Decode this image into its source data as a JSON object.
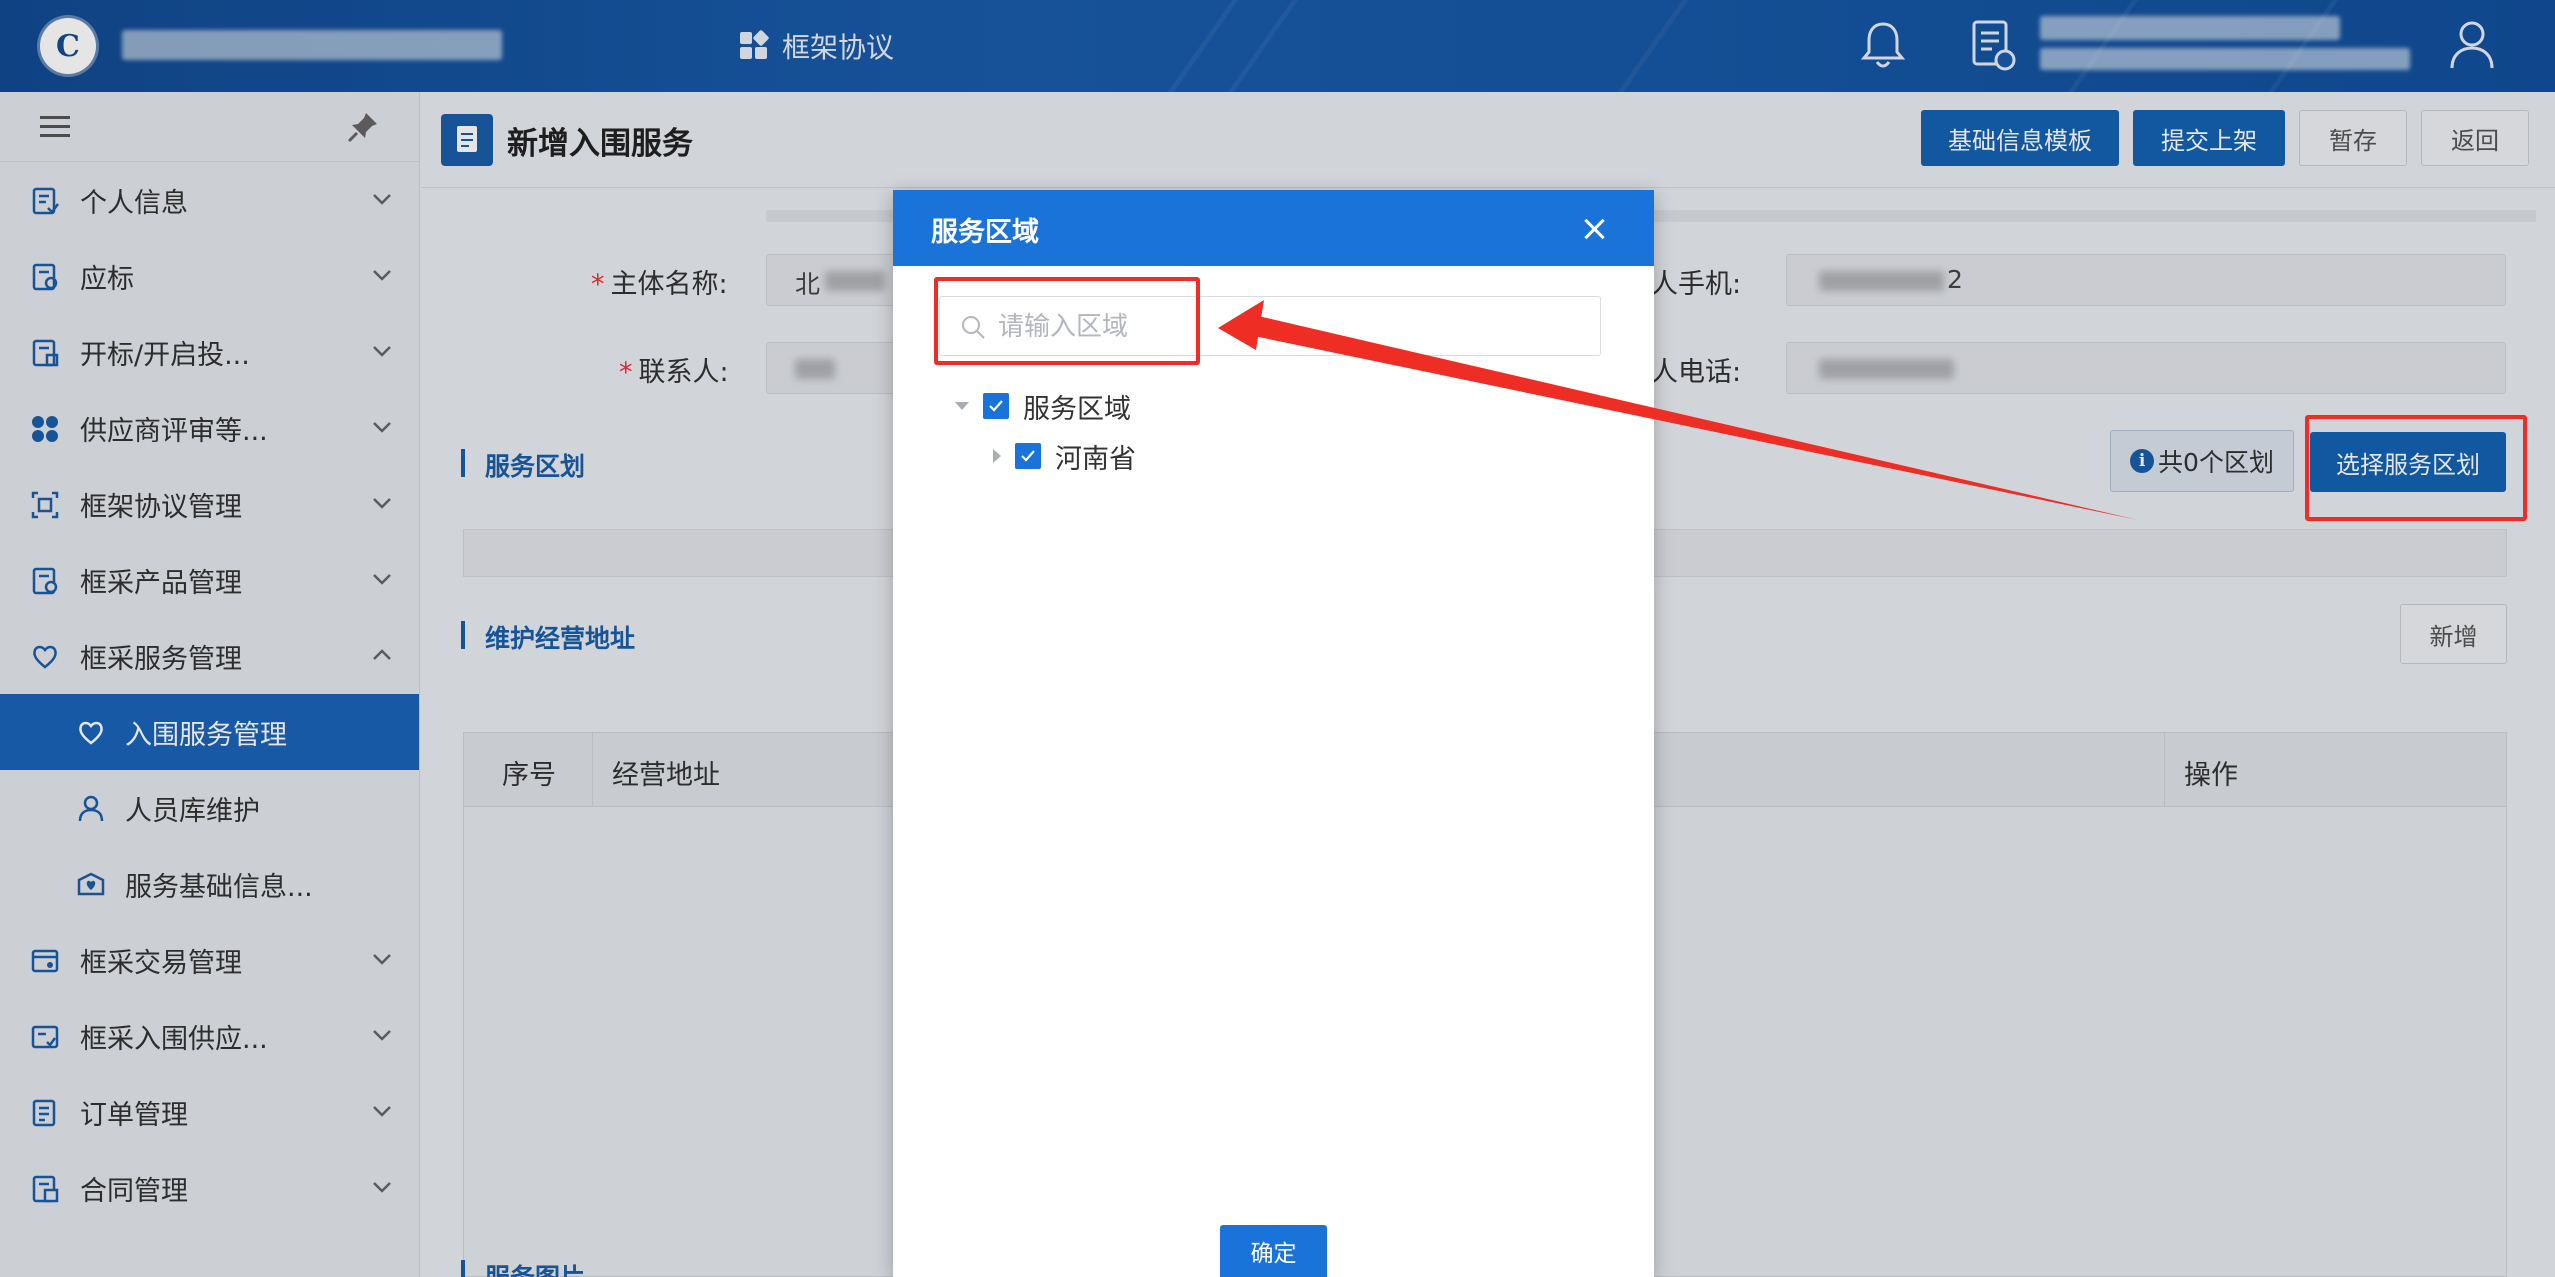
{
  "topbar": {
    "logo_letter": "C",
    "nav_label": "框架协议"
  },
  "sidebar": {
    "items": [
      {
        "label": "个人信息"
      },
      {
        "label": "应标"
      },
      {
        "label": "开标/开启投..."
      },
      {
        "label": "供应商评审等..."
      },
      {
        "label": "框架协议管理"
      },
      {
        "label": "框采产品管理"
      },
      {
        "label": "框采服务管理"
      },
      {
        "label": "入围服务管理"
      },
      {
        "label": "人员库维护"
      },
      {
        "label": "服务基础信息..."
      },
      {
        "label": "框采交易管理"
      },
      {
        "label": "框采入围供应..."
      },
      {
        "label": "订单管理"
      },
      {
        "label": "合同管理"
      }
    ]
  },
  "page": {
    "title": "新增入围服务",
    "buttons": {
      "template": "基础信息模板",
      "submit": "提交上架",
      "save": "暂存",
      "back": "返回"
    },
    "form": {
      "subject_label": "主体名称:",
      "subject_prefix": "北",
      "contact_label": "联系人:",
      "mobile_label": "人手机:",
      "mobile_suffix": "2",
      "phone_label": "人电话:"
    },
    "service_area": {
      "title": "服务区划",
      "count": "共0个区划",
      "select_button": "选择服务区划"
    },
    "address": {
      "title": "维护经营地址",
      "add_button": "新增",
      "columns": [
        "序号",
        "经营地址",
        "操作"
      ]
    },
    "bottom_section": "服务图片"
  },
  "dialog": {
    "title": "服务区域",
    "search_placeholder": "请输入区域",
    "tree": [
      {
        "label": "服务区域",
        "checked": true,
        "expanded": true
      },
      {
        "label": "河南省",
        "checked": true,
        "expanded": false
      }
    ],
    "ok": "确定"
  },
  "colors": {
    "primary": "#1a73d9",
    "topbar": "#1a5cab",
    "annotation": "#ee2d24"
  }
}
